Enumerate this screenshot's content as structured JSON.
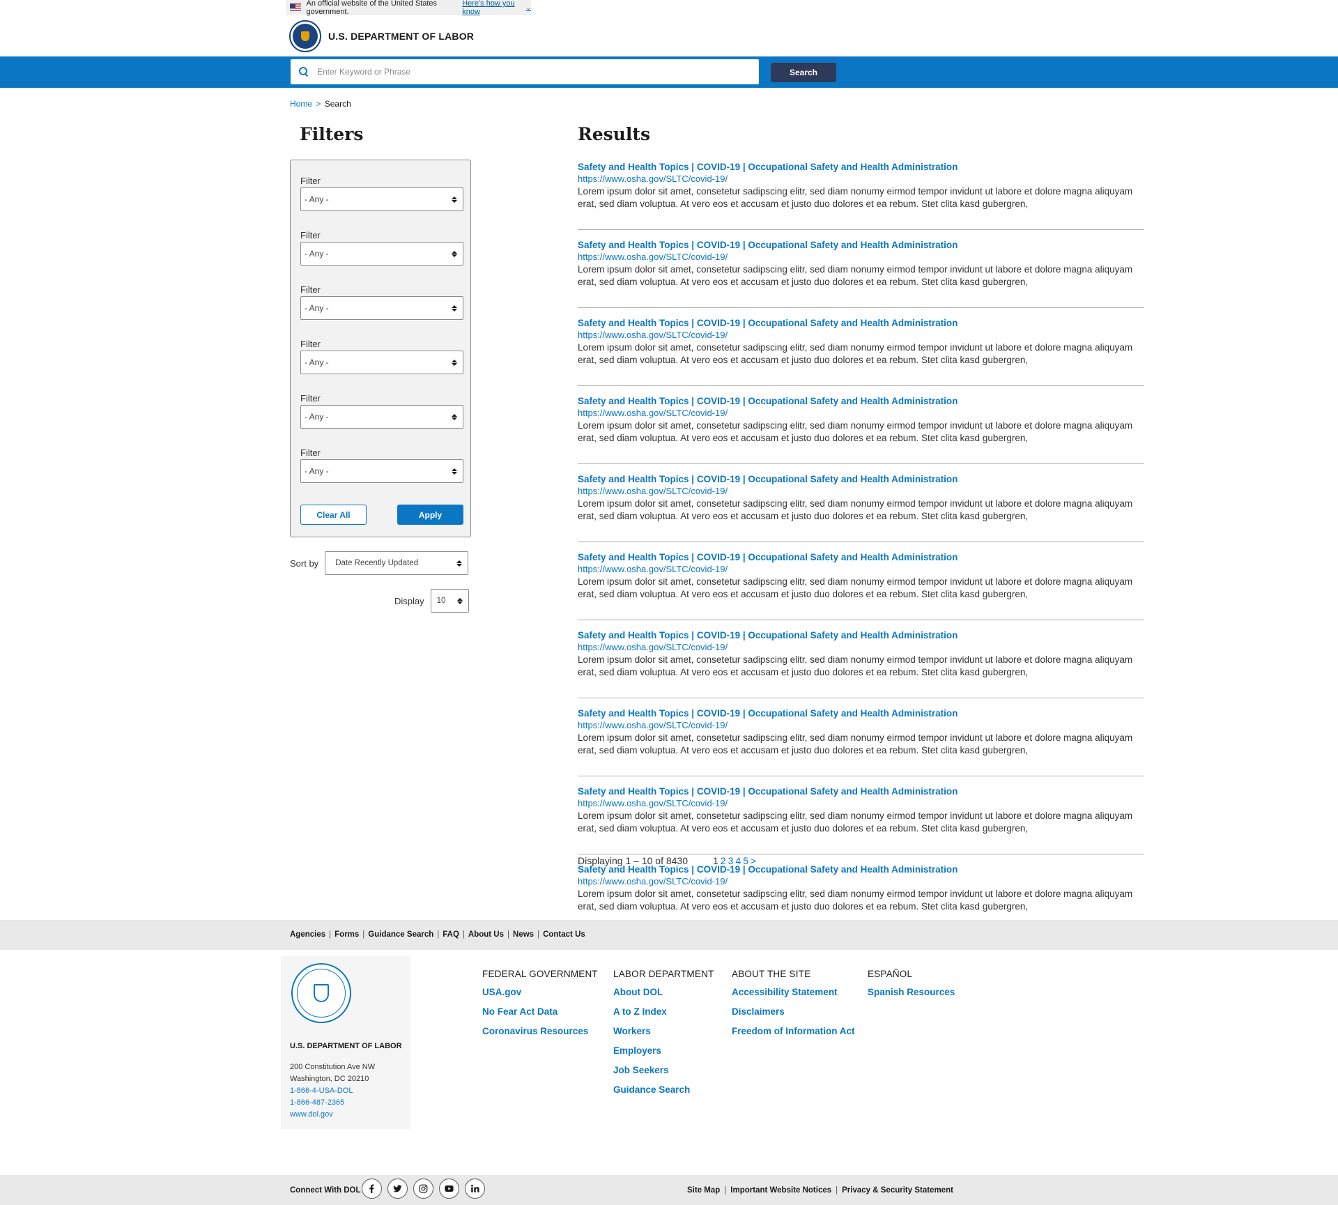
{
  "gov_banner": {
    "text": "An official website of the United States government.",
    "link": "Here's how you know"
  },
  "header": {
    "agency_name": "U.S. DEPARTMENT OF LABOR"
  },
  "search": {
    "placeholder": "Enter Keyword or Phrase",
    "button_label": "Search"
  },
  "breadcrumb": {
    "home": "Home",
    "separator": ">",
    "current": "Search"
  },
  "filters": {
    "heading": "Filters",
    "groups": [
      {
        "label": "Filter",
        "value": "- Any -"
      },
      {
        "label": "Filter",
        "value": "- Any -"
      },
      {
        "label": "Filter",
        "value": "- Any -"
      },
      {
        "label": "Filter",
        "value": "- Any -"
      },
      {
        "label": "Filter",
        "value": "- Any -"
      },
      {
        "label": "Filter",
        "value": "- Any -"
      }
    ],
    "clear_label": "Clear All",
    "apply_label": "Apply",
    "sort_label": "Sort by",
    "sort_value": "Date Recently Updated",
    "display_label": "Display",
    "display_value": "10"
  },
  "results": {
    "heading": "Results",
    "items": [
      {
        "title": "Safety and Health Topics | COVID-19 | Occupational Safety and Health Administration",
        "url": "https://www.osha.gov/SLTC/covid-19/",
        "description": "Lorem ipsum dolor sit amet, consetetur sadipscing elitr, sed diam nonumy eirmod tempor invidunt ut labore et dolore magna aliquyam erat, sed diam voluptua. At vero eos et accusam et justo duo dolores et ea rebum. Stet clita kasd gubergren,"
      },
      {
        "title": "Safety and Health Topics | COVID-19 | Occupational Safety and Health Administration",
        "url": "https://www.osha.gov/SLTC/covid-19/",
        "description": "Lorem ipsum dolor sit amet, consetetur sadipscing elitr, sed diam nonumy eirmod tempor invidunt ut labore et dolore magna aliquyam erat, sed diam voluptua. At vero eos et accusam et justo duo dolores et ea rebum. Stet clita kasd gubergren,"
      },
      {
        "title": "Safety and Health Topics | COVID-19 | Occupational Safety and Health Administration",
        "url": "https://www.osha.gov/SLTC/covid-19/",
        "description": "Lorem ipsum dolor sit amet, consetetur sadipscing elitr, sed diam nonumy eirmod tempor invidunt ut labore et dolore magna aliquyam erat, sed diam voluptua. At vero eos et accusam et justo duo dolores et ea rebum. Stet clita kasd gubergren,"
      },
      {
        "title": "Safety and Health Topics | COVID-19 | Occupational Safety and Health Administration",
        "url": "https://www.osha.gov/SLTC/covid-19/",
        "description": "Lorem ipsum dolor sit amet, consetetur sadipscing elitr, sed diam nonumy eirmod tempor invidunt ut labore et dolore magna aliquyam erat, sed diam voluptua. At vero eos et accusam et justo duo dolores et ea rebum. Stet clita kasd gubergren,"
      },
      {
        "title": "Safety and Health Topics | COVID-19 | Occupational Safety and Health Administration",
        "url": "https://www.osha.gov/SLTC/covid-19/",
        "description": "Lorem ipsum dolor sit amet, consetetur sadipscing elitr, sed diam nonumy eirmod tempor invidunt ut labore et dolore magna aliquyam erat, sed diam voluptua. At vero eos et accusam et justo duo dolores et ea rebum. Stet clita kasd gubergren,"
      },
      {
        "title": "Safety and Health Topics | COVID-19 | Occupational Safety and Health Administration",
        "url": "https://www.osha.gov/SLTC/covid-19/",
        "description": "Lorem ipsum dolor sit amet, consetetur sadipscing elitr, sed diam nonumy eirmod tempor invidunt ut labore et dolore magna aliquyam erat, sed diam voluptua. At vero eos et accusam et justo duo dolores et ea rebum. Stet clita kasd gubergren,"
      },
      {
        "title": "Safety and Health Topics | COVID-19 | Occupational Safety and Health Administration",
        "url": "https://www.osha.gov/SLTC/covid-19/",
        "description": "Lorem ipsum dolor sit amet, consetetur sadipscing elitr, sed diam nonumy eirmod tempor invidunt ut labore et dolore magna aliquyam erat, sed diam voluptua. At vero eos et accusam et justo duo dolores et ea rebum. Stet clita kasd gubergren,"
      },
      {
        "title": "Safety and Health Topics | COVID-19 | Occupational Safety and Health Administration",
        "url": "https://www.osha.gov/SLTC/covid-19/",
        "description": "Lorem ipsum dolor sit amet, consetetur sadipscing elitr, sed diam nonumy eirmod tempor invidunt ut labore et dolore magna aliquyam erat, sed diam voluptua. At vero eos et accusam et justo duo dolores et ea rebum. Stet clita kasd gubergren,"
      },
      {
        "title": "Safety and Health Topics | COVID-19 | Occupational Safety and Health Administration",
        "url": "https://www.osha.gov/SLTC/covid-19/",
        "description": "Lorem ipsum dolor sit amet, consetetur sadipscing elitr, sed diam nonumy eirmod tempor invidunt ut labore et dolore magna aliquyam erat, sed diam voluptua. At vero eos et accusam et justo duo dolores et ea rebum. Stet clita kasd gubergren,"
      },
      {
        "title": "Safety and Health Topics | COVID-19 | Occupational Safety and Health Administration",
        "url": "https://www.osha.gov/SLTC/covid-19/",
        "description": "Lorem ipsum dolor sit amet, consetetur sadipscing elitr, sed diam nonumy eirmod tempor invidunt ut labore et dolore magna aliquyam erat, sed diam voluptua. At vero eos et accusam et justo duo dolores et ea rebum. Stet clita kasd gubergren,"
      }
    ],
    "count_text": "Displaying 1 – 10 of 8430",
    "pages": [
      "1",
      "2",
      "3",
      "4",
      "5",
      ">"
    ],
    "current_page": "1"
  },
  "footer_nav": [
    "Agencies",
    "Forms",
    "Guidance Search",
    "FAQ",
    "About Us",
    "News",
    "Contact Us"
  ],
  "footer_card": {
    "title": "U.S. DEPARTMENT OF LABOR",
    "address_1": "200 Constitution Ave NW",
    "address_2": "Washington, DC 20210",
    "phone_1": "1-866-4-USA-DOL",
    "phone_2": "1-866-487-2365",
    "website": "www.dol.gov"
  },
  "footer_columns": [
    {
      "heading": "FEDERAL GOVERNMENT",
      "links": [
        "USA.gov",
        "No Fear Act Data",
        "Coronavirus Resources"
      ]
    },
    {
      "heading": "LABOR DEPARTMENT",
      "links": [
        "About DOL",
        "A to Z Index",
        "Workers",
        "Employers",
        "Job Seekers",
        "Guidance Search"
      ]
    },
    {
      "heading": "ABOUT THE SITE",
      "links": [
        "Accessibility Statement",
        "Disclaimers",
        "Freedom of Information Act"
      ]
    },
    {
      "heading": "ESPAÑOL",
      "links": [
        "Spanish Resources"
      ]
    }
  ],
  "bottom": {
    "connect_label": "Connect With DOL",
    "social_icons": [
      "facebook-icon",
      "twitter-icon",
      "instagram-icon",
      "youtube-icon",
      "linkedin-icon"
    ],
    "links": [
      "Site Map",
      "Important Website Notices",
      "Privacy & Security Statement"
    ]
  },
  "colors": {
    "accent_blue": "#0b77c4",
    "search_button": "#2e3a59",
    "footer_band": "#e9e9e9"
  }
}
